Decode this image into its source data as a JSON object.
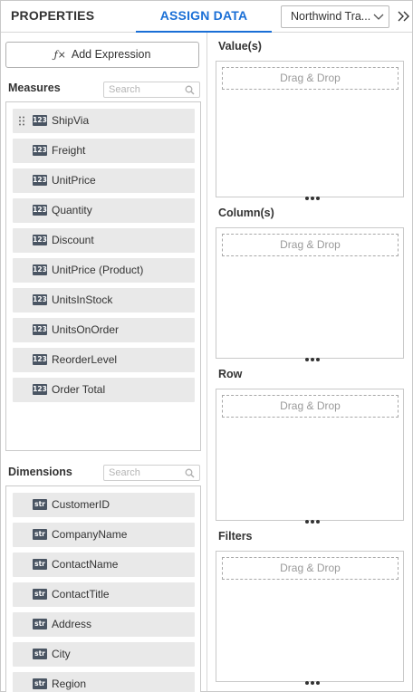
{
  "header": {
    "tabs": [
      {
        "label": "PROPERTIES",
        "active": false
      },
      {
        "label": "ASSIGN DATA",
        "active": true
      }
    ],
    "datasource": "Northwind Tra...",
    "accent_color": "#1a6fd6"
  },
  "left": {
    "add_expression_label": "Add Expression",
    "measures": {
      "title": "Measures",
      "search_placeholder": "Search",
      "items": [
        {
          "type": "123",
          "label": "ShipVia"
        },
        {
          "type": "123",
          "label": "Freight"
        },
        {
          "type": "123",
          "label": "UnitPrice"
        },
        {
          "type": "123",
          "label": "Quantity"
        },
        {
          "type": "123",
          "label": "Discount"
        },
        {
          "type": "123",
          "label": "UnitPrice (Product)"
        },
        {
          "type": "123",
          "label": "UnitsInStock"
        },
        {
          "type": "123",
          "label": "UnitsOnOrder"
        },
        {
          "type": "123",
          "label": "ReorderLevel"
        },
        {
          "type": "123",
          "label": "Order Total"
        }
      ]
    },
    "dimensions": {
      "title": "Dimensions",
      "search_placeholder": "Search",
      "items": [
        {
          "type": "str",
          "label": "CustomerID"
        },
        {
          "type": "str",
          "label": "CompanyName"
        },
        {
          "type": "str",
          "label": "ContactName"
        },
        {
          "type": "str",
          "label": "ContactTitle"
        },
        {
          "type": "str",
          "label": "Address"
        },
        {
          "type": "str",
          "label": "City"
        },
        {
          "type": "str",
          "label": "Region"
        }
      ]
    }
  },
  "zones": [
    {
      "title": "Value(s)",
      "drop_text": "Drag & Drop"
    },
    {
      "title": "Column(s)",
      "drop_text": "Drag & Drop"
    },
    {
      "title": "Row",
      "drop_text": "Drag & Drop"
    },
    {
      "title": "Filters",
      "drop_text": "Drag & Drop"
    }
  ]
}
